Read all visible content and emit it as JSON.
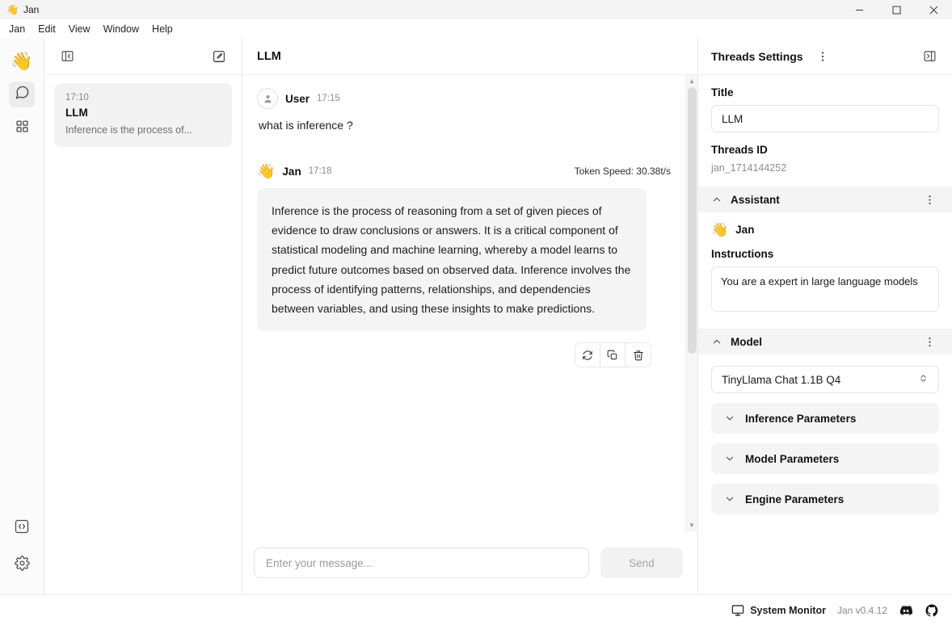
{
  "window": {
    "emoji": "👋",
    "title": "Jan",
    "controls": [
      {
        "name": "minimize-button",
        "glyph": "—"
      },
      {
        "name": "maximize-button",
        "glyph": "▢"
      },
      {
        "name": "close-button",
        "glyph": "✕"
      }
    ]
  },
  "menubar": {
    "items": [
      "Jan",
      "Edit",
      "View",
      "Window",
      "Help"
    ]
  },
  "rail": {
    "logo_emoji": "👋",
    "items": [
      {
        "name": "chat-icon",
        "active": true
      },
      {
        "name": "hub-grid-icon",
        "active": false
      }
    ],
    "bottom_items": [
      {
        "name": "code-api-icon"
      },
      {
        "name": "gear-icon"
      }
    ]
  },
  "threads_panel": {
    "collapse_icon": "panel-collapse-left-icon",
    "new_thread_icon": "new-chat-icon",
    "threads": [
      {
        "time": "17:10",
        "title": "LLM",
        "preview": "Inference is the process of..."
      }
    ]
  },
  "chat": {
    "header_title": "LLM",
    "messages": [
      {
        "role": "user",
        "author": "User",
        "time": "17:15",
        "avatar": "user-avatar-icon",
        "text": "what is inference ?"
      },
      {
        "role": "assistant",
        "author": "Jan",
        "time": "17:18",
        "avatar_emoji": "👋",
        "token_speed": "Token Speed: 30.38t/s",
        "text": "Inference is the process of reasoning from a set of given pieces of evidence to draw conclusions or answers. It is a critical component of statistical modeling and machine learning, whereby a model learns to predict future outcomes based on observed data. Inference involves the process of identifying patterns, relationships, and dependencies between variables, and using these insights to make predictions."
      }
    ],
    "actions": [
      {
        "name": "regenerate-button"
      },
      {
        "name": "copy-button"
      },
      {
        "name": "delete-button"
      }
    ],
    "composer": {
      "placeholder": "Enter your message...",
      "value": "",
      "send_label": "Send"
    }
  },
  "settings": {
    "title": "Threads Settings",
    "kebab_icon": "more-options-icon",
    "collapse_icon": "panel-collapse-right-icon",
    "title_field": {
      "label": "Title",
      "value": "LLM"
    },
    "threads_id": {
      "label": "Threads ID",
      "value": "jan_1714144252"
    },
    "assistant_section": {
      "label": "Assistant",
      "name": "Jan",
      "emoji": "👋",
      "instructions_label": "Instructions",
      "instructions_value": "You are a expert in large language models"
    },
    "model_section": {
      "label": "Model",
      "selected_model": "TinyLlama Chat 1.1B Q4",
      "accordions": [
        "Inference Parameters",
        "Model Parameters",
        "Engine Parameters"
      ]
    }
  },
  "statusbar": {
    "system_monitor_label": "System Monitor",
    "version": "Jan v0.4.12",
    "links": [
      {
        "name": "discord-icon"
      },
      {
        "name": "github-icon"
      }
    ]
  }
}
